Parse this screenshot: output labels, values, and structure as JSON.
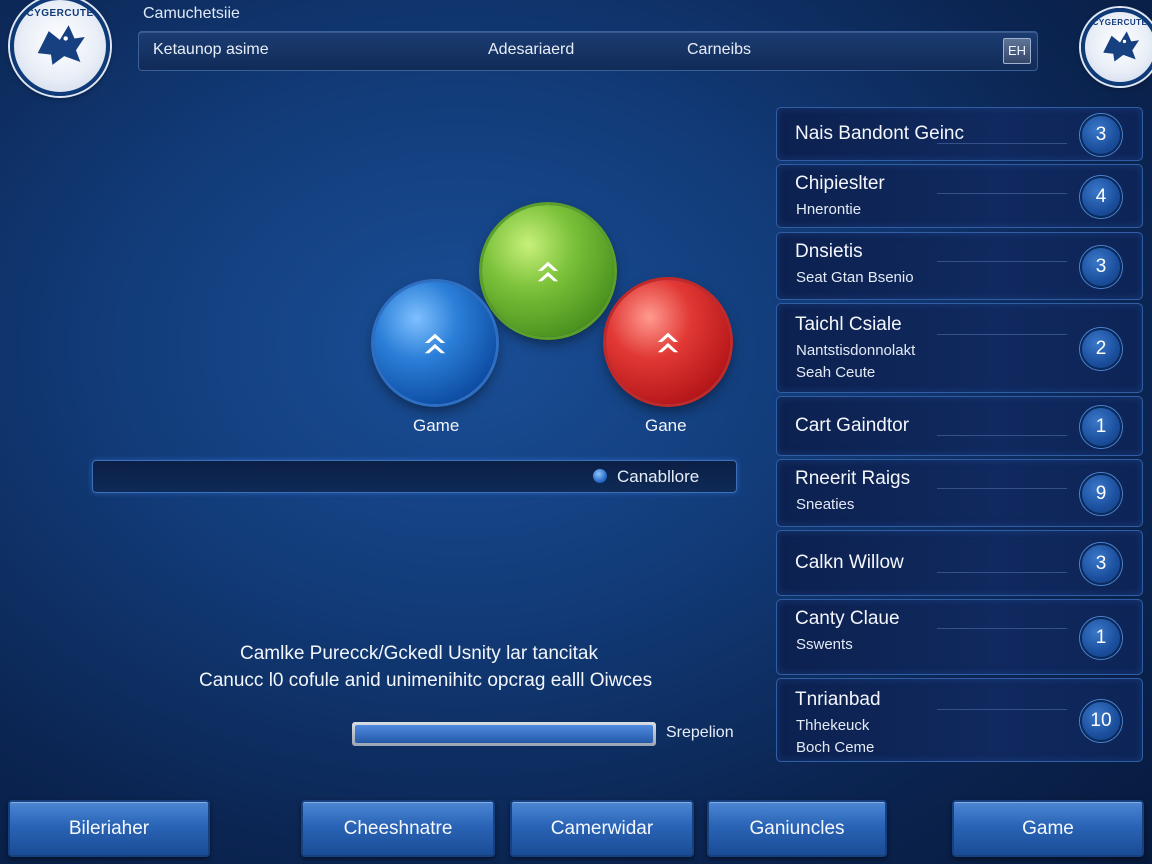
{
  "app": {
    "title": "Camuchetsiie"
  },
  "logos": {
    "left_text": "CYGERCUTE",
    "right_text": "CYGERCUTE"
  },
  "topbar": {
    "left_label": "Ketaunop asime",
    "center_label": "Adesariaerd",
    "right_label": "Carneibs",
    "button_label": "EH"
  },
  "game": {
    "blue_label": "Game",
    "red_label": "Gane",
    "colors": {
      "blue": "#2b7fd8",
      "green": "#7cc23a",
      "red": "#e13834"
    }
  },
  "status_bar": {
    "text": "Canabllore"
  },
  "description": {
    "line1": "Camlke Purecck/Gckedl Usnity lar tancitak",
    "line2": "Canucc l0 cofule anid unimenihitc opcrag ealll Oiwces"
  },
  "progress": {
    "value": 1.0,
    "label": "Srepelion"
  },
  "leaderboard": [
    {
      "title": "Nais Bandont Geinc",
      "lines": [],
      "badge": "3"
    },
    {
      "title": "Chipieslter",
      "lines": [
        "Hnerontie"
      ],
      "badge": "4"
    },
    {
      "title": "Dnsietis",
      "lines": [
        "Seat Gtan Bsenio"
      ],
      "badge": "3"
    },
    {
      "title": "Taichl Csiale",
      "lines": [
        "Nantstisdonnolakt",
        "Seah Ceute"
      ],
      "badge": "2"
    },
    {
      "title": "Cart Gaindtor",
      "lines": [],
      "badge": "1"
    },
    {
      "title": "Rneerit Raigs",
      "lines": [
        "Sneaties"
      ],
      "badge": "9"
    },
    {
      "title": "Calkn Willow",
      "lines": [],
      "badge": "3"
    },
    {
      "title": "Canty Claue",
      "lines": [
        "Sswents"
      ],
      "badge": "1"
    },
    {
      "title": "Tnrianbad",
      "lines": [
        "Thhekeuck",
        "Boch Ceme"
      ],
      "badge": "10"
    }
  ],
  "bottom_buttons": [
    "Bileriaher",
    "Cheeshnatre",
    "Camerwidar",
    "Ganiuncles",
    "Game"
  ]
}
